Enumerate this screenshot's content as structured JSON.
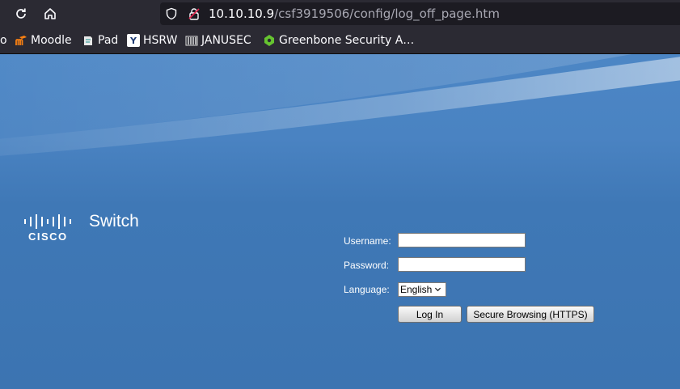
{
  "browser": {
    "url_host": "10.10.10.9",
    "url_path": "/csf3919506/config/log_off_page.htm",
    "bookmarks": [
      {
        "label": "o",
        "icon": "partial-bookmark-icon"
      },
      {
        "label": "Moodle",
        "icon": "moodle-icon"
      },
      {
        "label": "Pad",
        "icon": "pad-icon"
      },
      {
        "label": "HSRW",
        "icon": "hsrw-icon"
      },
      {
        "label": "JANUSEC",
        "icon": "janusec-icon"
      },
      {
        "label": "Greenbone Security A…",
        "icon": "greenbone-icon"
      }
    ]
  },
  "page": {
    "product_name": "Switch",
    "username_label": "Username:",
    "password_label": "Password:",
    "language_label": "Language:",
    "language_value": "English",
    "login_button": "Log In",
    "secure_button": "Secure Browsing (HTTPS)",
    "colors": {
      "background": "#3f76b4",
      "text": "#ffffff"
    }
  }
}
